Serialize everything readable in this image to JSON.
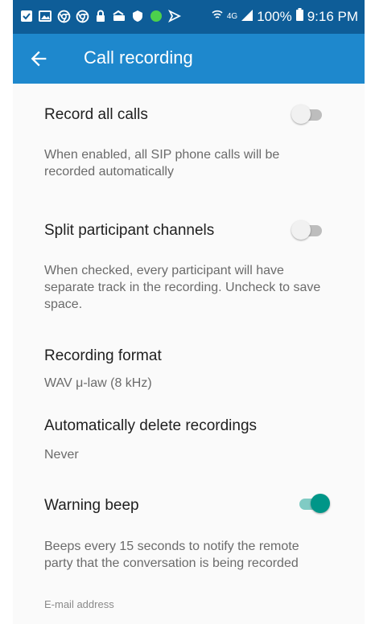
{
  "status_bar": {
    "left_icons": [
      "check-box-icon",
      "gallery-icon",
      "chrome-icon",
      "chrome-icon",
      "lock-icon",
      "wallet-icon",
      "shield-icon",
      "green-dot-icon",
      "video-icon"
    ],
    "network": "4G",
    "battery": "100%",
    "time": "9:16 PM"
  },
  "app_bar": {
    "title": "Call recording",
    "back_icon": "arrow-back-icon"
  },
  "settings": {
    "record_all": {
      "label": "Record all calls",
      "description": "When enabled, all SIP phone calls will be recorded automatically",
      "enabled": false
    },
    "split_channels": {
      "label": "Split participant channels",
      "description": "When checked, every participant will have separate track in the recording. Uncheck to save space.",
      "enabled": false
    },
    "format": {
      "label": "Recording format",
      "value": "WAV μ-law (8 kHz)"
    },
    "auto_delete": {
      "label": "Automatically delete recordings",
      "value": "Never"
    },
    "warning_beep": {
      "label": "Warning beep",
      "description": "Beeps every 15 seconds to notify the remote party that the conversation is being recorded",
      "enabled": true
    },
    "email": {
      "placeholder": "E-mail address"
    }
  },
  "colors": {
    "status_bar": "#0e5d98",
    "app_bar": "#1e88cd",
    "toggle_on": "#009688",
    "toggle_off": "#bdbdbd"
  }
}
